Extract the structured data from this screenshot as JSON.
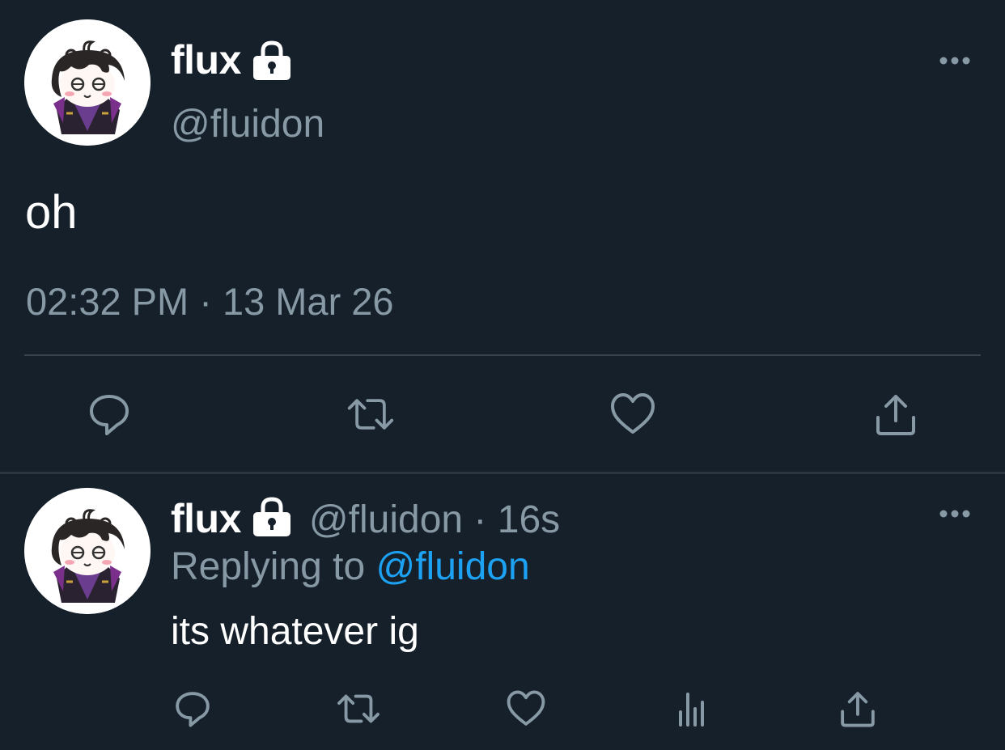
{
  "main_tweet": {
    "display_name": "flux",
    "handle": "@fluidon",
    "protected_icon": "lock-icon",
    "text": "oh",
    "timestamp": "02:32 PM · 13 Mar 26",
    "avatar": "anime-chibi-avatar",
    "actions": [
      "reply-icon",
      "retweet-icon",
      "like-icon",
      "share-icon"
    ]
  },
  "reply_tweet": {
    "display_name": "flux",
    "handle": "@fluidon",
    "separator": "·",
    "age": "16s",
    "replying_prefix": "Replying to",
    "replying_mention": "@fluidon",
    "text": "its whatever ig",
    "avatar": "anime-chibi-avatar",
    "actions": [
      "reply-icon",
      "retweet-icon",
      "like-icon",
      "stats-icon",
      "share-icon"
    ]
  },
  "colors": {
    "background": "#15202b",
    "secondary_text": "#8899a6",
    "accent": "#1da1f2",
    "divider": "#38444d"
  }
}
